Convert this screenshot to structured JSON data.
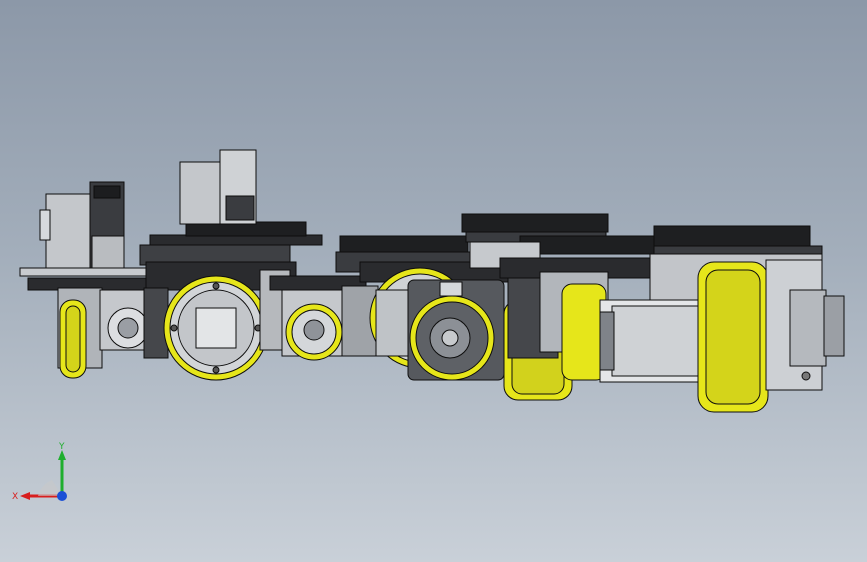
{
  "triad": {
    "x_label": "X",
    "y_label": "Y",
    "colors": {
      "x": "#d81e1e",
      "y": "#1fae2e",
      "z": "#1a4fd6"
    }
  },
  "colors": {
    "wheel_yellow": "#e6e61a",
    "metal_light": "#d6d9dc",
    "metal_mid": "#a7abb0",
    "metal_dark": "#4a4d52",
    "gear_black": "#1d1e20",
    "outline": "#0d0d0d"
  }
}
